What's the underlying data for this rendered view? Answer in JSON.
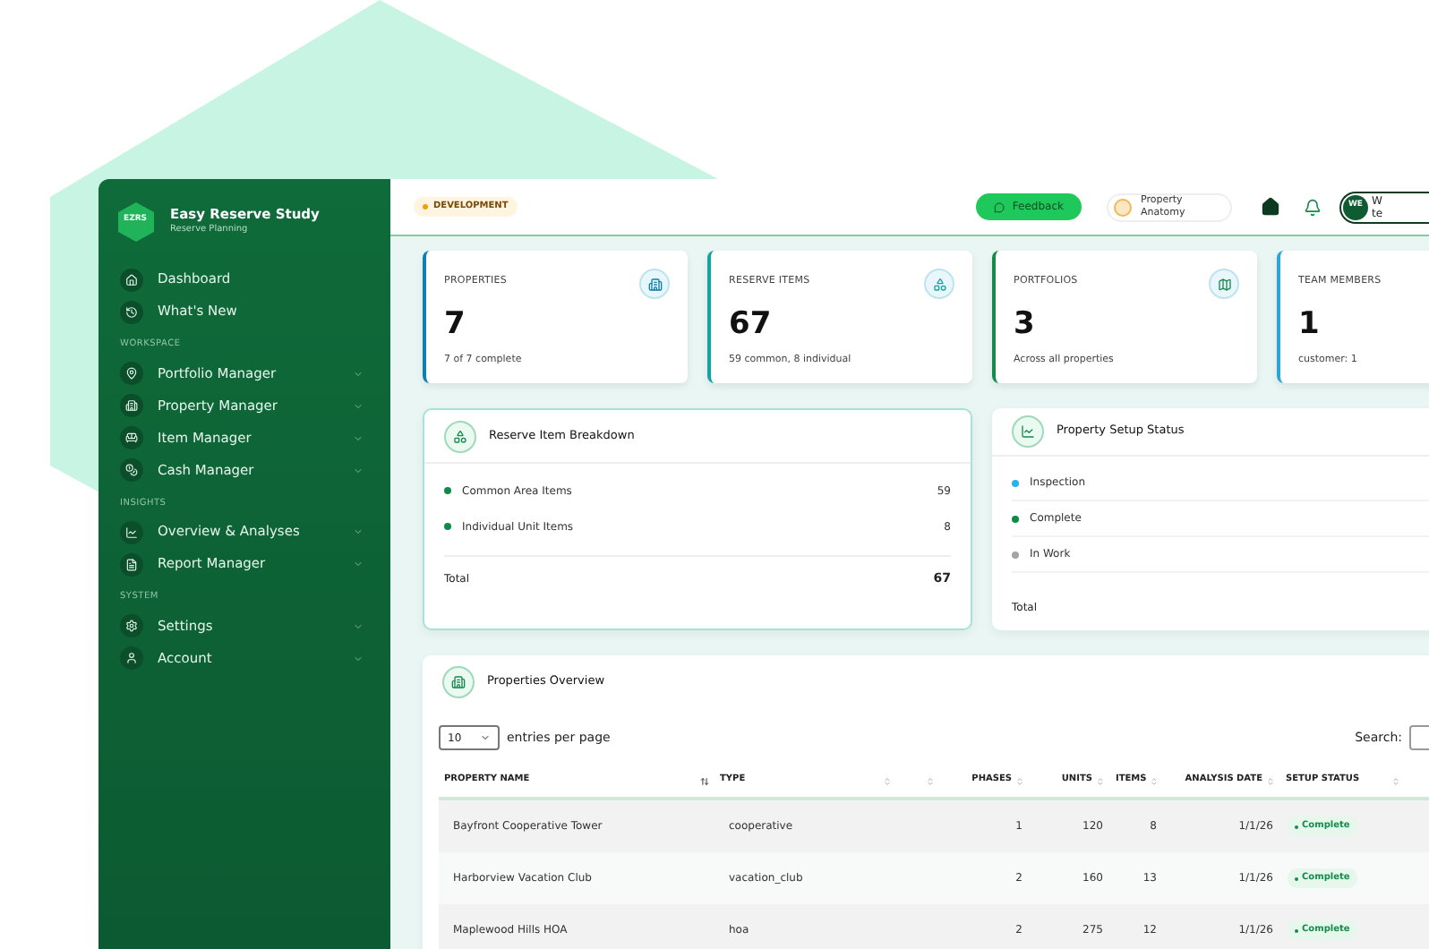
{
  "brand": {
    "logo": "EZRS",
    "title": "Easy Reserve Study",
    "subtitle": "Reserve Planning"
  },
  "sidebar": {
    "sections": [
      {
        "items": [
          {
            "label": "Dashboard",
            "expandable": false
          },
          {
            "label": "What's New",
            "expandable": false
          }
        ]
      },
      {
        "heading": "WORKSPACE",
        "items": [
          {
            "label": "Portfolio Manager",
            "expandable": true
          },
          {
            "label": "Property Manager",
            "expandable": true
          },
          {
            "label": "Item Manager",
            "expandable": true
          },
          {
            "label": "Cash Manager",
            "expandable": true
          }
        ]
      },
      {
        "heading": "INSIGHTS",
        "items": [
          {
            "label": "Overview & Analyses",
            "expandable": true
          },
          {
            "label": "Report Manager",
            "expandable": true
          }
        ]
      },
      {
        "heading": "SYSTEM",
        "items": [
          {
            "label": "Settings",
            "expandable": true
          },
          {
            "label": "Account",
            "expandable": true
          }
        ]
      }
    ]
  },
  "topbar": {
    "environment": "DEVELOPMENT",
    "feedback": "Feedback",
    "company": {
      "line1": "Property",
      "line2": "Anatomy"
    },
    "avatar": "WE",
    "user_line1": "W",
    "user_line2": "te"
  },
  "stats": [
    {
      "label": "PROPERTIES",
      "value": "7",
      "note": "7 of 7 complete",
      "color": "#0e7fb0"
    },
    {
      "label": "RESERVE ITEMS",
      "value": "67",
      "note": "59 common, 8 individual",
      "color": "#13a3a3"
    },
    {
      "label": "PORTFOLIOS",
      "value": "3",
      "note": "Across all properties",
      "color": "#168a4c"
    },
    {
      "label": "TEAM MEMBERS",
      "value": "1",
      "note": "customer: 1",
      "color": "#2ba5d6"
    }
  ],
  "breakdown": {
    "title": "Reserve Item Breakdown",
    "rows": [
      {
        "label": "Common Area Items",
        "value": "59",
        "color": "#0f8a4a"
      },
      {
        "label": "Individual Unit Items",
        "value": "8",
        "color": "#0f8a4a"
      }
    ],
    "total_label": "Total",
    "total": "67"
  },
  "setup_status": {
    "title": "Property Setup Status",
    "rows": [
      {
        "label": "Inspection",
        "color": "#2bb3e8"
      },
      {
        "label": "Complete",
        "color": "#0f8a4a"
      },
      {
        "label": "In Work",
        "color": "#a3a3a3"
      }
    ],
    "total_label": "Total"
  },
  "overview": {
    "title": "Properties Overview",
    "page_size": "10",
    "page_size_label": "entries per page",
    "search_label": "Search:",
    "columns": [
      {
        "label": "PROPERTY NAME",
        "sorted": true
      },
      {
        "label": "TYPE",
        "sorted": false
      },
      {
        "sorted": false
      },
      {
        "label": "PHASES",
        "sorted": false
      },
      {
        "label": "UNITS",
        "sorted": false
      },
      {
        "label": "ITEMS",
        "sorted": false
      },
      {
        "label": "ANALYSIS DATE",
        "sorted": false
      },
      {
        "label": "SETUP STATUS",
        "sorted": false
      }
    ],
    "rows": [
      {
        "cells": [
          "Bayfront Cooperative Tower",
          "cooperative",
          "",
          "1",
          "120",
          "8",
          "1/1/26"
        ],
        "status": "Complete"
      },
      {
        "cells": [
          "Harborview Vacation Club",
          "vacation_club",
          "",
          "2",
          "160",
          "13",
          "1/1/26"
        ],
        "status": "Complete"
      },
      {
        "cells": [
          "Maplewood Hills HOA",
          "hoa",
          "",
          "2",
          "275",
          "12",
          "1/1/26"
        ],
        "status": "Complete"
      }
    ]
  }
}
